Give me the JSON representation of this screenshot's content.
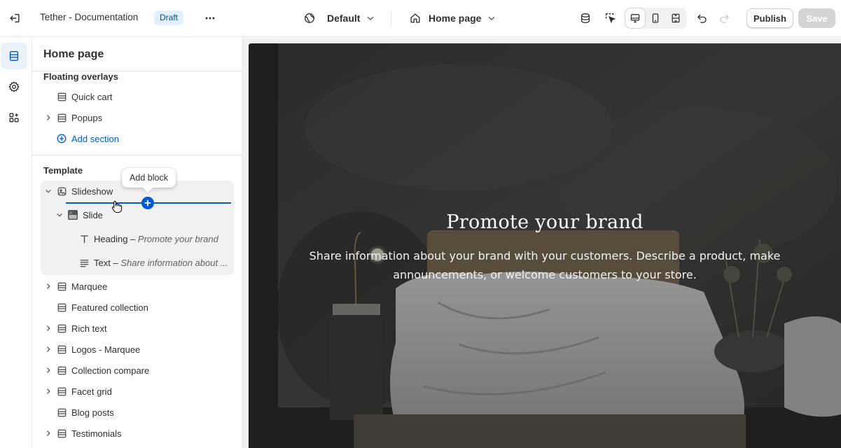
{
  "topbar": {
    "store_title": "Tether - Documentation",
    "status_badge": "Draft",
    "theme_selector": "Default",
    "page_selector": "Home page",
    "publish_label": "Publish",
    "save_label": "Save"
  },
  "sidebar": {
    "title": "Home page",
    "floating_overlays": {
      "title": "Floating overlays",
      "items": [
        {
          "label": "Quick cart",
          "icon": "section-icon",
          "expandable": false
        },
        {
          "label": "Popups",
          "icon": "section-icon",
          "expandable": true
        }
      ],
      "add_section": "Add section"
    },
    "template": {
      "title": "Template",
      "tooltip": "Add block",
      "slideshow": {
        "label": "Slideshow",
        "icon": "slideshow-icon"
      },
      "slide": {
        "label": "Slide",
        "icon": "image-thumbnail-icon"
      },
      "heading_block": {
        "name": "Heading",
        "sep": " – ",
        "value": "Promote your brand"
      },
      "text_block": {
        "name": "Text",
        "sep": " – ",
        "value": "Share information about ..."
      },
      "sections": [
        {
          "label": "Marquee",
          "expandable": true
        },
        {
          "label": "Featured collection",
          "expandable": false
        },
        {
          "label": "Rich text",
          "expandable": true
        },
        {
          "label": "Logos - Marquee",
          "expandable": true
        },
        {
          "label": "Collection compare",
          "expandable": true
        },
        {
          "label": "Facet grid",
          "expandable": true
        },
        {
          "label": "Blog posts",
          "expandable": false
        },
        {
          "label": "Testimonials",
          "expandable": true
        }
      ]
    }
  },
  "preview": {
    "heading": "Promote your brand",
    "subheading": "Share information about your brand with your customers. Describe a product, make announcements, or welcome customers to your store."
  },
  "colors": {
    "accent": "#005bd3",
    "badge_bg": "#e0f0ff",
    "badge_text": "#00527c",
    "selected_bg": "#f1f1f1"
  }
}
